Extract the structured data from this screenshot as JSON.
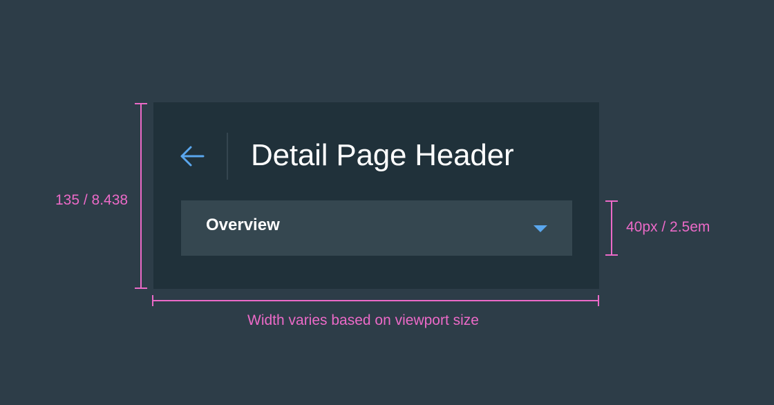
{
  "header": {
    "title": "Detail Page Header",
    "back_icon": "arrow-left-icon",
    "dropdown": {
      "selected": "Overview",
      "icon": "caret-down-icon"
    }
  },
  "annotations": {
    "height_label": "135 / 8.438",
    "dropdown_height_label": "40px / 2.5em",
    "width_label": "Width varies based on viewport size"
  },
  "colors": {
    "page_background": "#2d3d48",
    "header_background": "#20313a",
    "dropdown_background": "#354750",
    "accent": "#5aa7ee",
    "annotation": "#ec6ac8"
  }
}
